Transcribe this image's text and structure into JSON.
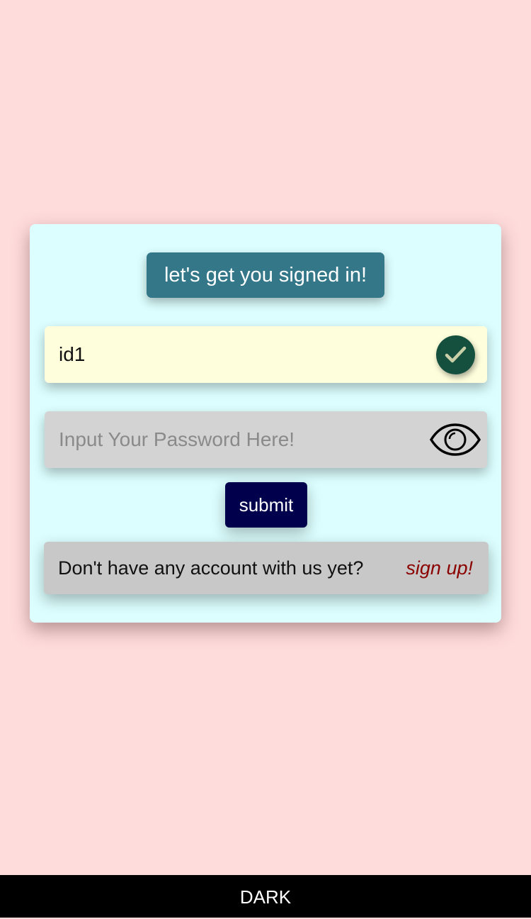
{
  "login_card": {
    "heading": "let's get you signed in!",
    "username": {
      "value": "id1",
      "status_icon": "check-icon"
    },
    "password": {
      "value": "",
      "placeholder": "Input Your Password Here!",
      "toggle_icon": "eye-icon"
    },
    "submit_label": "submit",
    "signup_prompt": "Don't have any account with us yet?",
    "signup_link": "sign up!"
  },
  "theme_toggle": {
    "label": "DARK"
  },
  "colors": {
    "page_background": "#ffdcdc",
    "card_background": "#dcfefe",
    "heading_chip": "#337788",
    "username_field": "#fefedc",
    "password_field": "#d3d3d3",
    "check_badge": "#15503f",
    "submit_button": "#00004d",
    "signup_row": "#c8c8c8",
    "signup_link": "#8b0000",
    "theme_bar": "#000000"
  }
}
